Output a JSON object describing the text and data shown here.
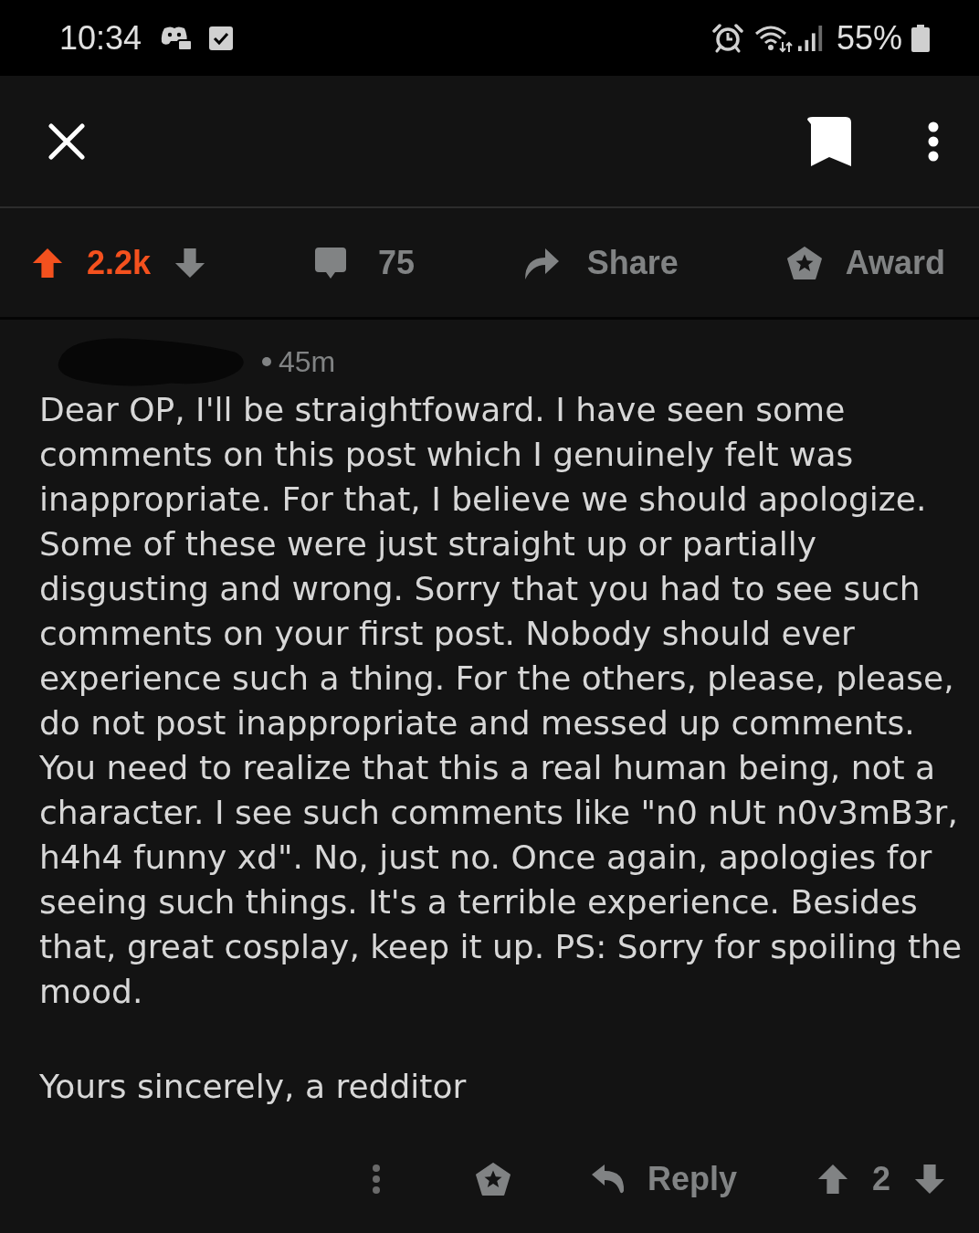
{
  "status_bar": {
    "time": "10:34",
    "battery": "55%"
  },
  "post_actions": {
    "upvoted": true,
    "downvoted": false,
    "score": "2.2k",
    "comments": "75",
    "share": "Share",
    "award": "Award"
  },
  "comment": {
    "age": "45m",
    "paragraphs": [
      "Dear OP, I'll be straightfoward. I have seen some comments on this post which I genuinely felt was inappropriate. For that, I believe we should apologize. Some of these were just straight up or partially disgusting and wrong. Sorry that you had to see such comments on your first post. Nobody should ever experience such a thing. For the others, please, please, do not post inappropriate and messed up comments. You need to realize that this a real human being, not a character. I see such comments like \"n0 nUt n0v3mB3r, h4h4 funny xd\". No, just no. Once again, apologies for seeing such things. It's a terrible experience. Besides that, great cosplay, keep it up. PS: Sorry for spoiling the mood.",
      "Yours sincerely, a redditor"
    ],
    "actions": {
      "reply": "Reply",
      "upvoted": false,
      "downvoted": false,
      "score": "2"
    }
  }
}
